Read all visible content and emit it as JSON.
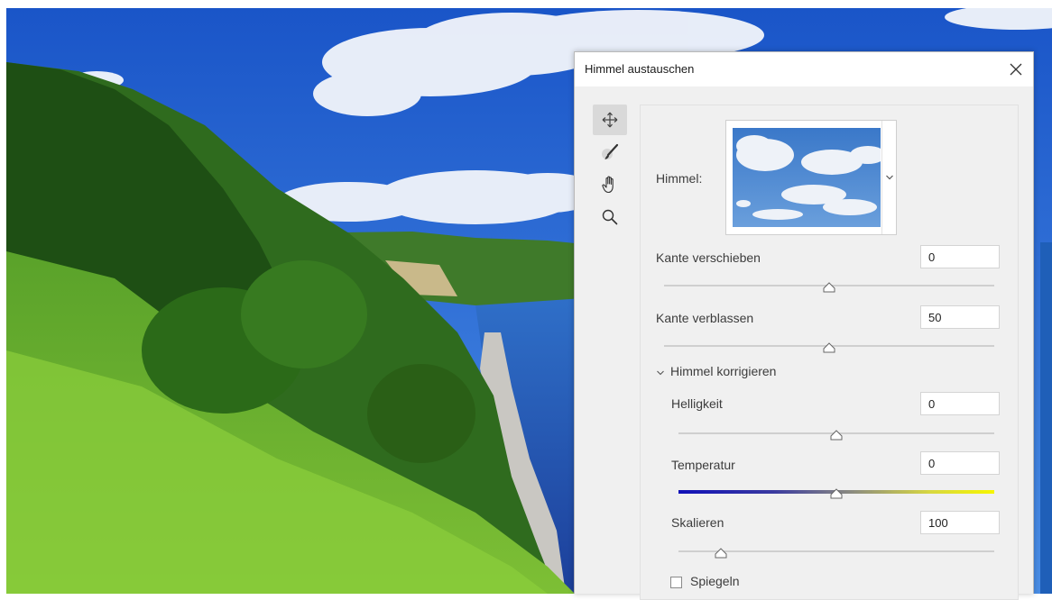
{
  "dialog": {
    "title": "Himmel austauschen"
  },
  "tools": [
    {
      "name": "move-tool",
      "icon": "move-icon"
    },
    {
      "name": "sky-brush-tool",
      "icon": "brush-icon"
    },
    {
      "name": "hand-tool",
      "icon": "hand-icon"
    },
    {
      "name": "zoom-tool",
      "icon": "zoom-icon"
    }
  ],
  "sky": {
    "label": "Himmel:"
  },
  "settings": {
    "kante_verschieben": {
      "label": "Kante verschieben",
      "value": "0",
      "slider_fraction": 0.5
    },
    "kante_verblassen": {
      "label": "Kante verblassen",
      "value": "50",
      "slider_fraction": 0.5
    }
  },
  "himmel_korrigieren": {
    "label": "Himmel korrigieren",
    "helligkeit": {
      "label": "Helligkeit",
      "value": "0",
      "slider_fraction": 0.5
    },
    "temperatur": {
      "label": "Temperatur",
      "value": "0",
      "slider_fraction": 0.5
    },
    "skalieren": {
      "label": "Skalieren",
      "value": "100",
      "slider_fraction": 0.13
    }
  },
  "spiegeln": {
    "label": "Spiegeln",
    "checked": false
  },
  "colors": {
    "dialog_bg": "#f0f0f0",
    "temp_cold": "#1010b8",
    "temp_warm": "#f6f600"
  }
}
